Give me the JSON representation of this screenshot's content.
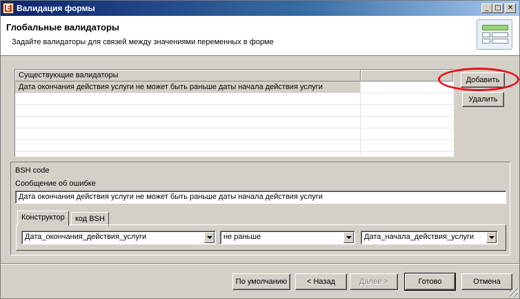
{
  "window": {
    "title": "Валидация формы"
  },
  "header": {
    "title": "Глобальные валидаторы",
    "subtitle": "Задайте валидаторы для связей между значениями переменных в форме"
  },
  "table": {
    "columns": [
      "Существующие валидаторы",
      ""
    ],
    "rows": [
      [
        "Дата окончания действия услуги не может быть раньше даты начала действия услуги",
        ""
      ]
    ]
  },
  "side_buttons": {
    "add": "Добавить",
    "delete": "Удалить"
  },
  "bsh": {
    "code_label": "BSH code",
    "error_label": "Сообщение об ошибке",
    "error_value": "Дата окончания действия услуги не может быть раньше даты начала действия услуги",
    "tabs": [
      "Конструктор",
      "код BSH"
    ],
    "constructor": {
      "left": "Дата_окончания_действия_услуги",
      "operator": "не раньше",
      "right": "Дата_начала_действия_услуги"
    }
  },
  "footer": {
    "default": "По умолчанию",
    "back": "< Назад",
    "next": "Далее >",
    "finish": "Готово",
    "cancel": "Отмена"
  },
  "colors": {
    "highlight": "#e8101a",
    "title_bar": "#0a246a"
  }
}
